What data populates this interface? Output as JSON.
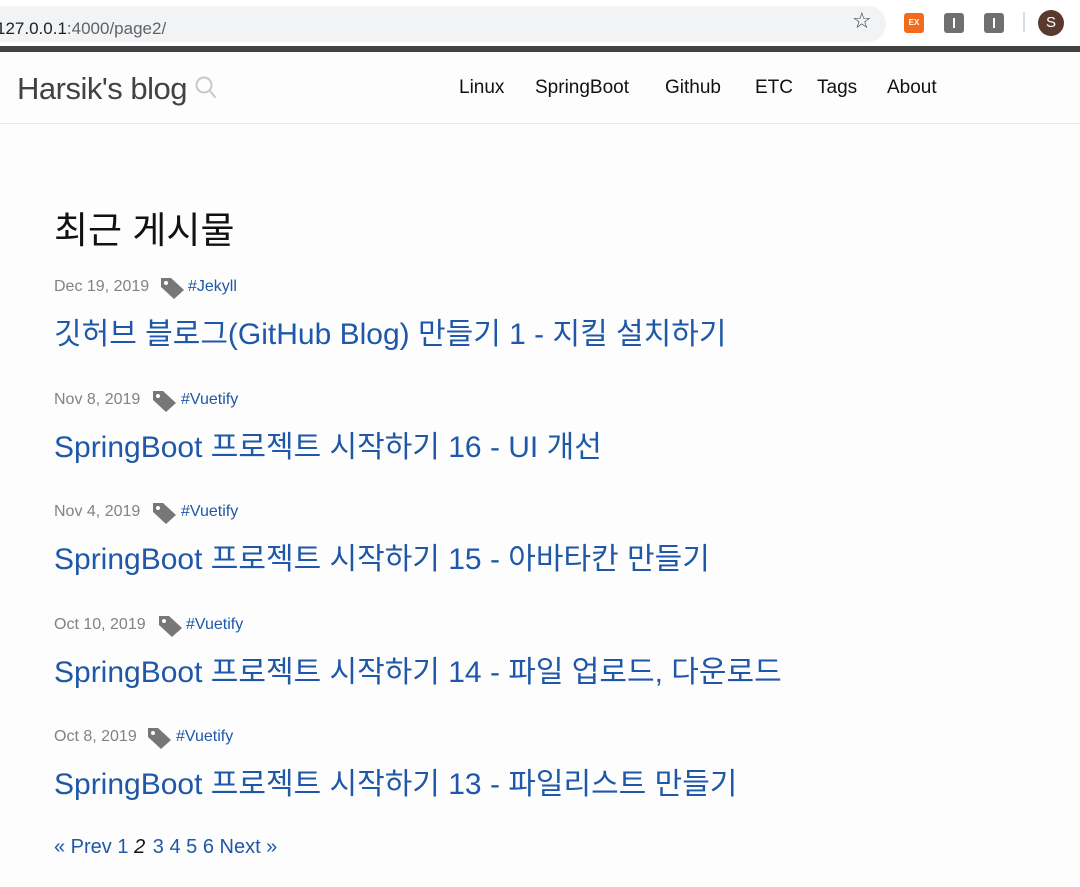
{
  "browser": {
    "url_host": "127.0.0.1",
    "url_rest": ":4000/page2/",
    "ext_ex_label": "EX",
    "avatar_letter": "S"
  },
  "site": {
    "title": "Harsik's blog",
    "nav": [
      "Linux",
      "SpringBoot",
      "Github",
      "ETC",
      "Tags",
      "About"
    ]
  },
  "main": {
    "heading": "최근 게시물",
    "posts": [
      {
        "date": "Dec 19, 2019",
        "tag": "#Jekyll",
        "title": "깃허브 블로그(GitHub Blog) 만들기 1 - 지킬 설치하기"
      },
      {
        "date": "Nov 8, 2019",
        "tag": "#Vuetify",
        "title": "SpringBoot 프로젝트 시작하기 16 - UI 개선"
      },
      {
        "date": "Nov 4, 2019",
        "tag": "#Vuetify",
        "title": "SpringBoot 프로젝트 시작하기 15 - 아바타칸 만들기"
      },
      {
        "date": "Oct 10, 2019",
        "tag": "#Vuetify",
        "title": "SpringBoot 프로젝트 시작하기 14 - 파일 업로드, 다운로드"
      },
      {
        "date": "Oct 8, 2019",
        "tag": "#Vuetify",
        "title": "SpringBoot 프로젝트 시작하기 13 - 파일리스트 만들기"
      }
    ]
  },
  "pagination": {
    "prev": "« Prev",
    "pages": [
      "1",
      "2",
      "3",
      "4",
      "5",
      "6"
    ],
    "current": "2",
    "next": "Next »"
  }
}
